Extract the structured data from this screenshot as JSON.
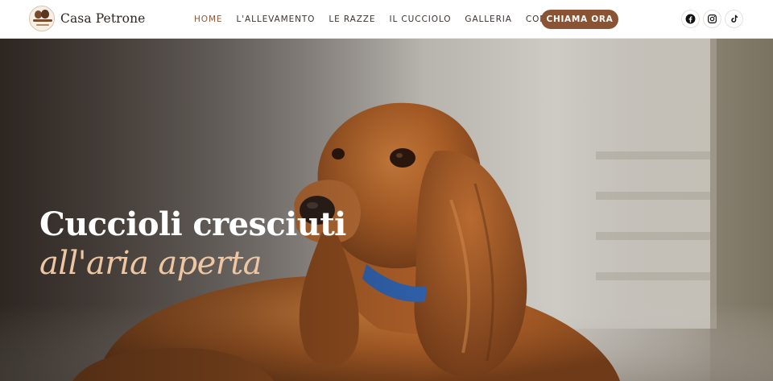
{
  "brand": {
    "name": "Casa Petrone",
    "logo_icon": "puppies-logo-icon"
  },
  "nav": {
    "items": [
      {
        "label": "HOME",
        "active": true
      },
      {
        "label": "L'ALLEVAMENTO",
        "active": false
      },
      {
        "label": "LE RAZZE",
        "active": false
      },
      {
        "label": "IL CUCCIOLO",
        "active": false
      },
      {
        "label": "GALLERIA",
        "active": false
      },
      {
        "label": "CONTATTI",
        "active": false
      }
    ]
  },
  "cta": {
    "label": "CHIAMA ORA"
  },
  "social": [
    {
      "icon": "facebook-icon"
    },
    {
      "icon": "instagram-icon"
    },
    {
      "icon": "tiktok-icon"
    }
  ],
  "hero": {
    "title": "Cuccioli cresciuti",
    "subtitle": "all'aria aperta",
    "image": "cocker-spaniel-photo"
  },
  "colors": {
    "accent": "#8a5334",
    "active_nav": "#8a5a3a",
    "subtitle": "#eec7a2",
    "text_dark": "#2e2622"
  }
}
